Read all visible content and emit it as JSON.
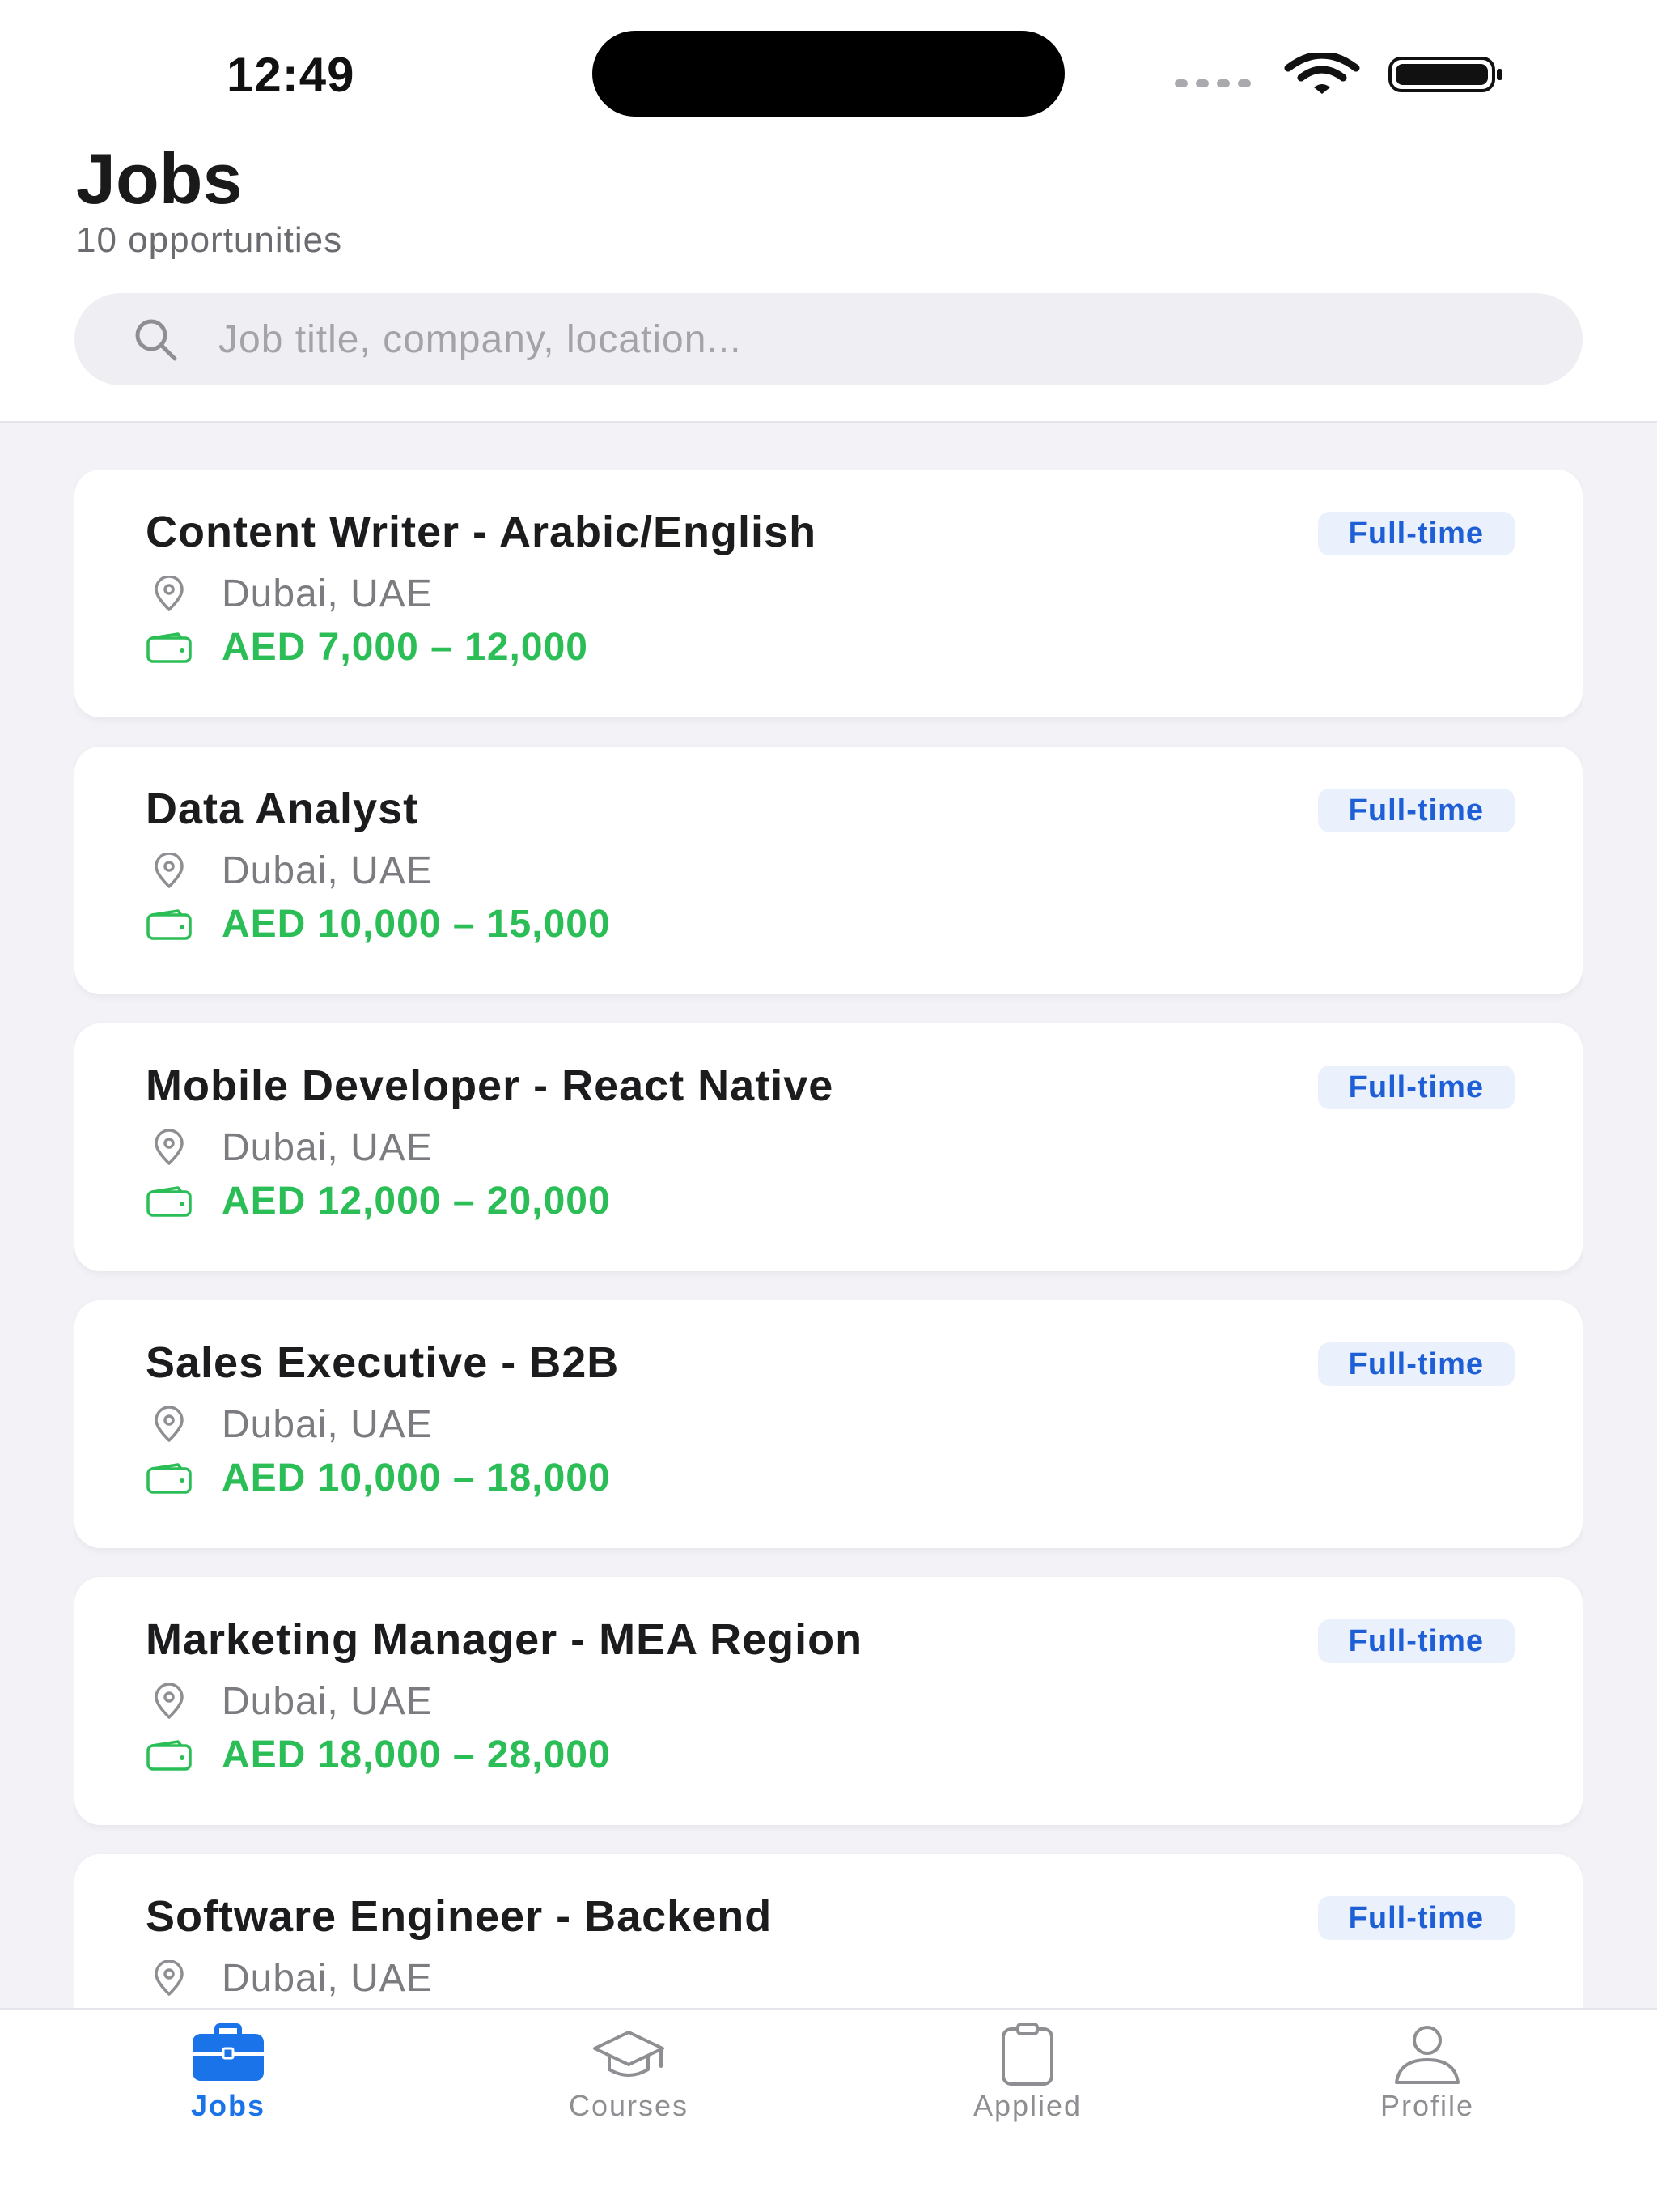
{
  "status_bar": {
    "time": "12:49"
  },
  "header": {
    "title": "Jobs",
    "subtitle": "10 opportunities"
  },
  "search": {
    "placeholder": "Job title, company, location...",
    "value": ""
  },
  "jobs": [
    {
      "title": "Content Writer - Arabic/English",
      "type": "Full-time",
      "location": "Dubai, UAE",
      "salary": "AED 7,000 – 12,000"
    },
    {
      "title": "Data Analyst",
      "type": "Full-time",
      "location": "Dubai, UAE",
      "salary": "AED 10,000 – 15,000"
    },
    {
      "title": "Mobile Developer - React Native",
      "type": "Full-time",
      "location": "Dubai, UAE",
      "salary": "AED 12,000 – 20,000"
    },
    {
      "title": "Sales Executive - B2B",
      "type": "Full-time",
      "location": "Dubai, UAE",
      "salary": "AED 10,000 – 18,000"
    },
    {
      "title": "Marketing Manager - MEA Region",
      "type": "Full-time",
      "location": "Dubai, UAE",
      "salary": "AED 18,000 – 28,000"
    },
    {
      "title": "Software Engineer - Backend",
      "type": "Full-time",
      "location": "Dubai, UAE",
      "salary": ""
    }
  ],
  "tabs": [
    {
      "label": "Jobs",
      "icon": "briefcase-icon",
      "active": true
    },
    {
      "label": "Courses",
      "icon": "graduation-cap-icon",
      "active": false
    },
    {
      "label": "Applied",
      "icon": "clipboard-icon",
      "active": false
    },
    {
      "label": "Profile",
      "icon": "person-icon",
      "active": false
    }
  ],
  "colors": {
    "accent": "#1a73e8",
    "salary": "#2bbd56",
    "badge_bg": "#eaf1fd",
    "badge_text": "#1f5fd6",
    "background": "#f2f2f7"
  }
}
